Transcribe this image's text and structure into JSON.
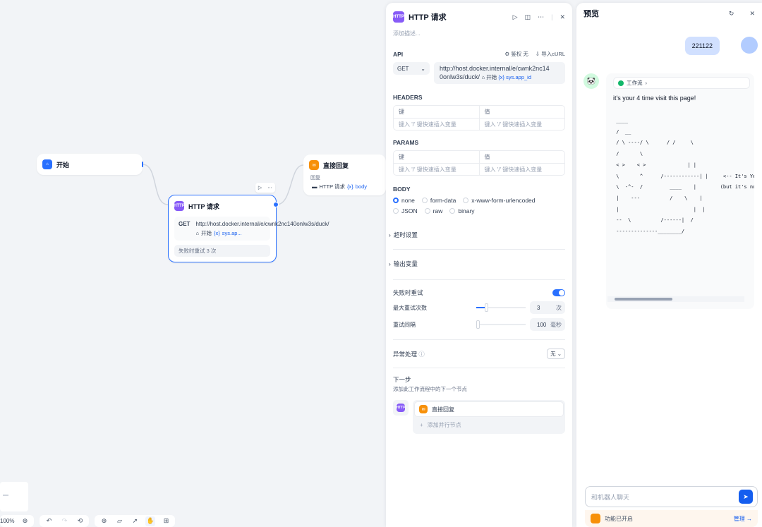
{
  "canvas": {
    "start_node": {
      "title": "开始"
    },
    "http_node": {
      "title": "HTTP 请求",
      "method": "GET",
      "url": "http://host.docker.internal/e/cwnk2nc140onlw3s/duck/",
      "var_node": "开始",
      "var_name": "sys.ap...",
      "retry_text": "失败时重试 3 次"
    },
    "reply_node": {
      "title": "直接回复",
      "label": "回复",
      "var_node": "HTTP 请求",
      "var_name": "body"
    },
    "zoom": "100%"
  },
  "panel": {
    "title": "HTTP 请求",
    "description_placeholder": "添加描述...",
    "api_label": "API",
    "auth_label": "鉴权 无",
    "import_curl": "导入cURL",
    "method": "GET",
    "url_line1": "http://host.docker.internal/e/cwnk2nc14",
    "url_line2": "0onlw3s/duck/",
    "url_var_node": "开始",
    "url_var_name": "sys.app_id",
    "headers_label": "HEADERS",
    "params_label": "PARAMS",
    "key_header": "键",
    "value_header": "值",
    "key_placeholder": "键入 '/' 键快速插入变量",
    "value_placeholder": "键入 '/' 键快速插入变量",
    "body_label": "BODY",
    "body_options": [
      "none",
      "form-data",
      "x-www-form-urlencoded",
      "JSON",
      "raw",
      "binary"
    ],
    "body_selected": "none",
    "timeout_label": "超时设置",
    "output_label": "输出变量",
    "retry_label": "失败时重试",
    "retry_enabled": true,
    "max_retries_label": "最大重试次数",
    "max_retries_value": "3",
    "max_retries_unit": "次",
    "max_retries_fraction": 0.2,
    "interval_label": "重试间隔",
    "interval_value": "100",
    "interval_unit": "毫秒",
    "interval_fraction": 0.0,
    "error_label": "异常处理",
    "error_value": "无",
    "next_label": "下一步",
    "next_sub": "添加此工作流程中的下一个节点",
    "next_node": "直接回复",
    "add_parallel": "添加并行节点"
  },
  "preview": {
    "title": "预览",
    "user_message": "221122",
    "workflow_chip": "工作流",
    "bot_text": "it's your 4 time visit this page!",
    "ascii_lines": [
      " ____",
      " /  __",
      " / \\ ----/ \\      / /     \\",
      " /       \\",
      " < >    < >              | |",
      " \\       ^      /------------| |     <-- It's Yeuc",
      " \\  -^-  /         ____    |        (but it's not",
      " |    ---          /    \\    |",
      " |                         |  |",
      " --  \\          /------|  /",
      " --------------________/"
    ],
    "input_placeholder": "和机器人聊天",
    "feature_text": "功能已开启",
    "manage_label": "管理"
  }
}
